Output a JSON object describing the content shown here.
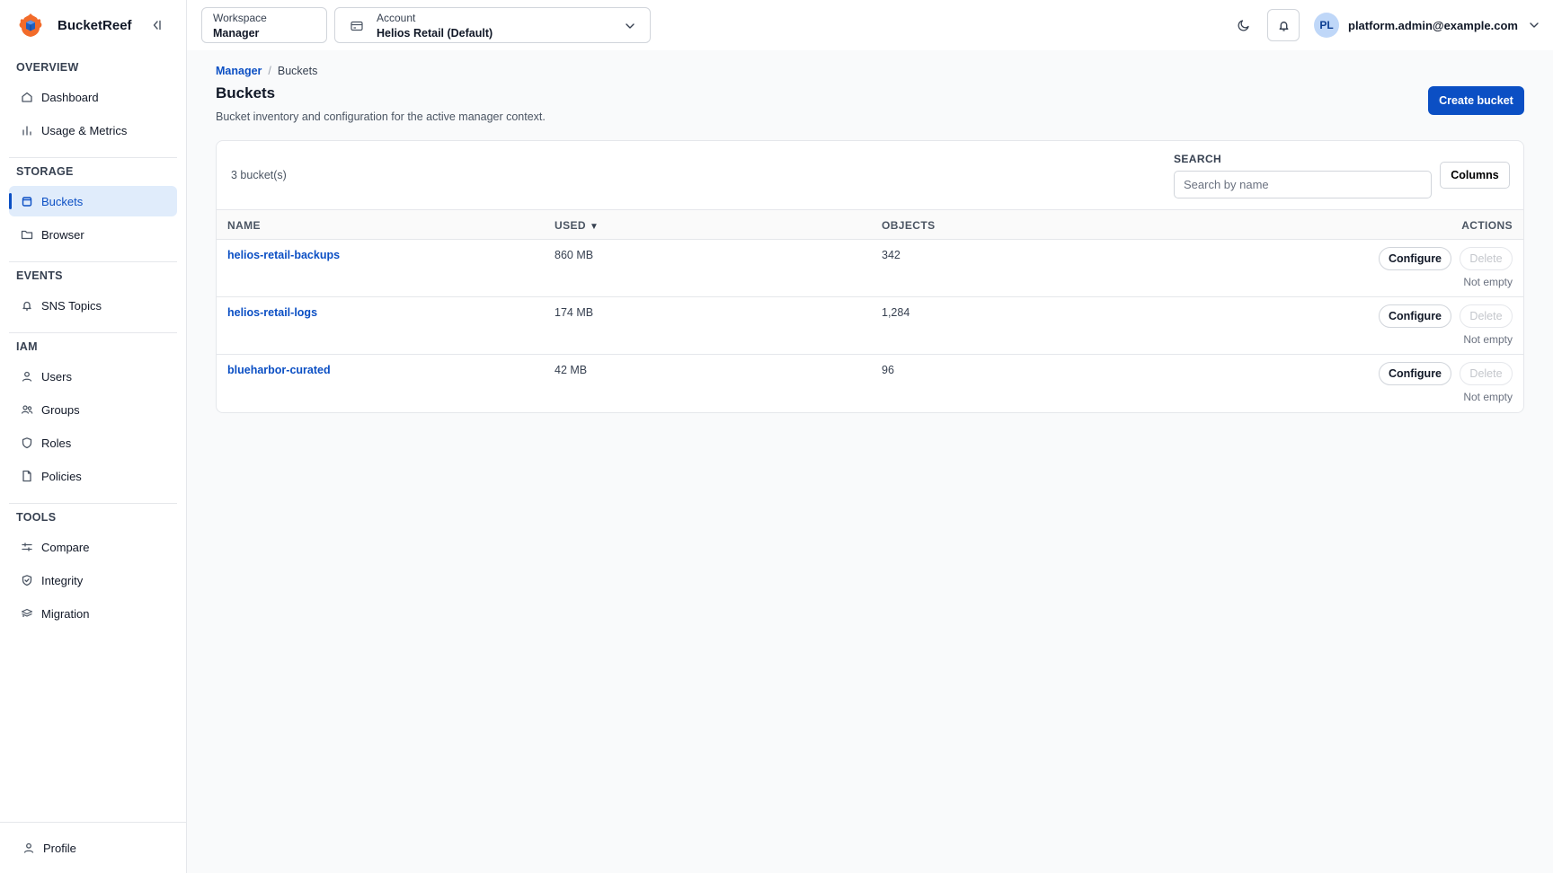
{
  "app": {
    "name": "BucketReef"
  },
  "sidebar": {
    "sections": [
      {
        "title": "OVERVIEW",
        "items": [
          {
            "label": "Dashboard",
            "icon": "home-icon"
          },
          {
            "label": "Usage & Metrics",
            "icon": "bar-chart-icon"
          }
        ]
      },
      {
        "title": "STORAGE",
        "items": [
          {
            "label": "Buckets",
            "icon": "bucket-icon",
            "active": true
          },
          {
            "label": "Browser",
            "icon": "folder-icon"
          }
        ]
      },
      {
        "title": "EVENTS",
        "items": [
          {
            "label": "SNS Topics",
            "icon": "bell-icon"
          }
        ]
      },
      {
        "title": "IAM",
        "items": [
          {
            "label": "Users",
            "icon": "user-icon"
          },
          {
            "label": "Groups",
            "icon": "users-icon"
          },
          {
            "label": "Roles",
            "icon": "shield-icon"
          },
          {
            "label": "Policies",
            "icon": "file-icon"
          }
        ]
      },
      {
        "title": "TOOLS",
        "items": [
          {
            "label": "Compare",
            "icon": "compare-icon"
          },
          {
            "label": "Integrity",
            "icon": "shield-check-icon"
          },
          {
            "label": "Migration",
            "icon": "layers-icon"
          }
        ]
      }
    ],
    "footer": {
      "label": "Profile",
      "icon": "user-icon"
    }
  },
  "topbar": {
    "workspace": {
      "label": "Workspace",
      "value": "Manager"
    },
    "account": {
      "label": "Account",
      "value": "Helios Retail (Default)"
    },
    "user": {
      "initials": "PL",
      "email": "platform.admin@example.com"
    }
  },
  "page": {
    "breadcrumb": {
      "parent": "Manager",
      "separator": "/",
      "current": "Buckets"
    },
    "title": "Buckets",
    "subtitle": "Bucket inventory and configuration for the active manager context.",
    "create_label": "Create bucket"
  },
  "table": {
    "count": "3 bucket(s)",
    "search": {
      "label": "SEARCH",
      "placeholder": "Search by name",
      "value": ""
    },
    "columns_label": "Columns",
    "headers": {
      "name": "NAME",
      "used": "USED",
      "sort": "▼",
      "objects": "OBJECTS",
      "actions": "ACTIONS"
    },
    "rows": [
      {
        "name": "helios-retail-backups",
        "used": "860 MB",
        "objects": "342",
        "configure": "Configure",
        "delete": "Delete",
        "note": "Not empty"
      },
      {
        "name": "helios-retail-logs",
        "used": "174 MB",
        "objects": "1,284",
        "configure": "Configure",
        "delete": "Delete",
        "note": "Not empty"
      },
      {
        "name": "blueharbor-curated",
        "used": "42 MB",
        "objects": "96",
        "configure": "Configure",
        "delete": "Delete",
        "note": "Not empty"
      }
    ]
  },
  "colors": {
    "accent": "#0b4fc4",
    "active_bg": "#e0ecfb",
    "border": "#e5e7eb"
  }
}
